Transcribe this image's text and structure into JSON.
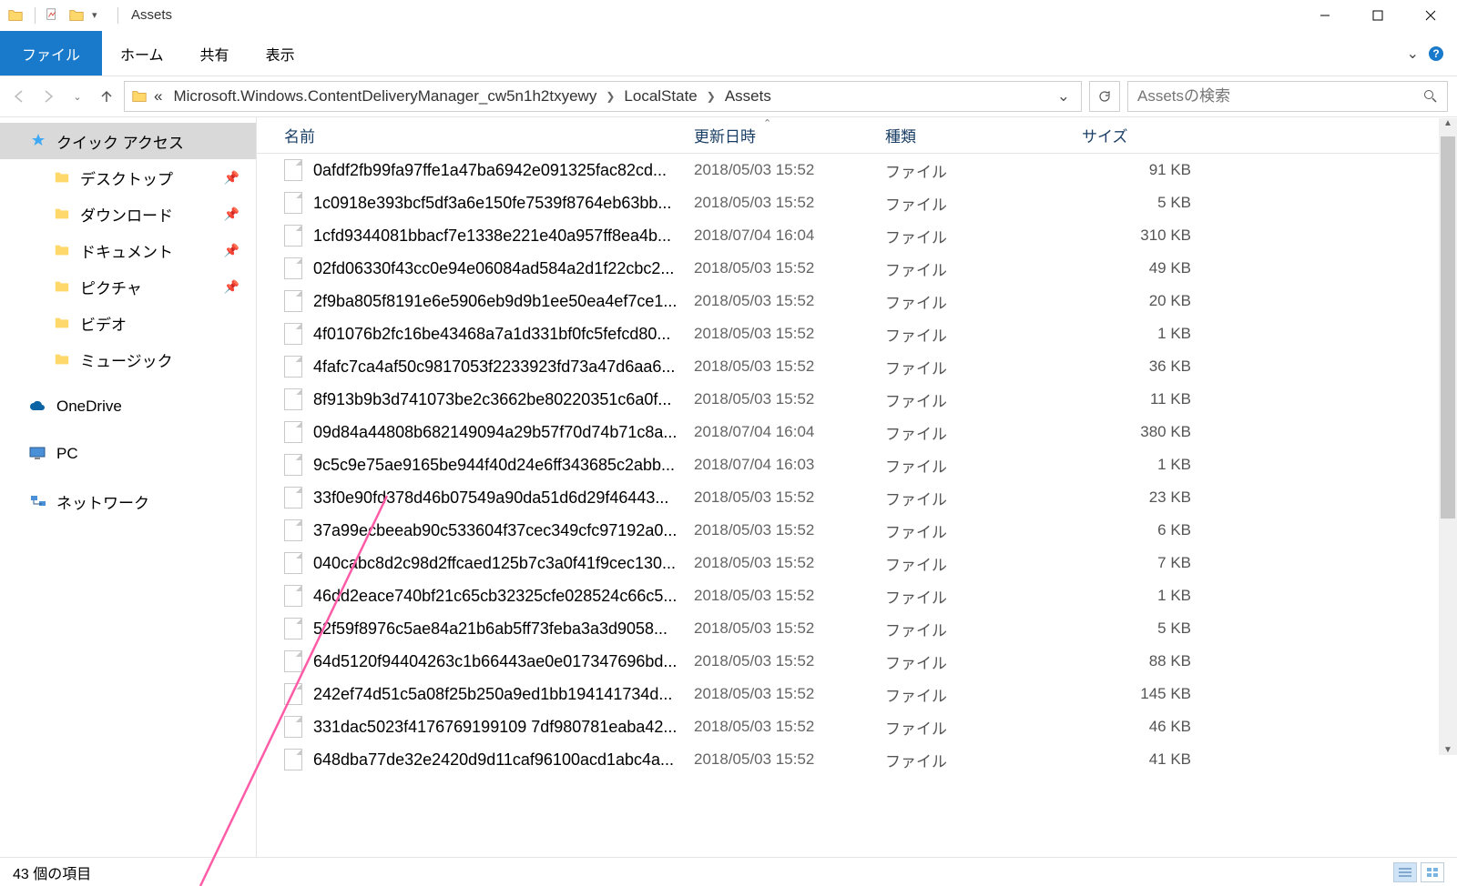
{
  "window": {
    "title": "Assets"
  },
  "ribbon": {
    "file": "ファイル",
    "home": "ホーム",
    "share": "共有",
    "view": "表示"
  },
  "breadcrumb": {
    "prefix": "«",
    "parts": [
      "Microsoft.Windows.ContentDeliveryManager_cw5n1h2txyewy",
      "LocalState",
      "Assets"
    ]
  },
  "search": {
    "placeholder": "Assetsの検索"
  },
  "nav": {
    "quick": "クイック アクセス",
    "desktop": "デスクトップ",
    "downloads": "ダウンロード",
    "documents": "ドキュメント",
    "pictures": "ピクチャ",
    "videos": "ビデオ",
    "music": "ミュージック",
    "onedrive": "OneDrive",
    "pc": "PC",
    "network": "ネットワーク"
  },
  "columns": {
    "name": "名前",
    "date": "更新日時",
    "type": "種類",
    "size": "サイズ"
  },
  "files": [
    {
      "name": "0afdf2fb99fa97ffe1a47ba6942e091325fac82cd...",
      "date": "2018/05/03 15:52",
      "type": "ファイル",
      "size": "91 KB"
    },
    {
      "name": "1c0918e393bcf5df3a6e150fe7539f8764eb63bb...",
      "date": "2018/05/03 15:52",
      "type": "ファイル",
      "size": "5 KB"
    },
    {
      "name": "1cfd9344081bbacf7e1338e221e40a957ff8ea4b...",
      "date": "2018/07/04 16:04",
      "type": "ファイル",
      "size": "310 KB"
    },
    {
      "name": "02fd06330f43cc0e94e06084ad584a2d1f22cbc2...",
      "date": "2018/05/03 15:52",
      "type": "ファイル",
      "size": "49 KB"
    },
    {
      "name": "2f9ba805f8191e6e5906eb9d9b1ee50ea4ef7ce1...",
      "date": "2018/05/03 15:52",
      "type": "ファイル",
      "size": "20 KB"
    },
    {
      "name": "4f01076b2fc16be43468a7a1d331bf0fc5fefcd80...",
      "date": "2018/05/03 15:52",
      "type": "ファイル",
      "size": "1 KB"
    },
    {
      "name": "4fafc7ca4af50c9817053f2233923fd73a47d6aa6...",
      "date": "2018/05/03 15:52",
      "type": "ファイル",
      "size": "36 KB"
    },
    {
      "name": "8f913b9b3d741073be2c3662be80220351c6a0f...",
      "date": "2018/05/03 15:52",
      "type": "ファイル",
      "size": "11 KB"
    },
    {
      "name": "09d84a44808b682149094a29b57f70d74b71c8a...",
      "date": "2018/07/04 16:04",
      "type": "ファイル",
      "size": "380 KB"
    },
    {
      "name": "9c5c9e75ae9165be944f40d24e6ff343685c2abb...",
      "date": "2018/07/04 16:03",
      "type": "ファイル",
      "size": "1 KB"
    },
    {
      "name": "33f0e90fd378d46b07549a90da51d6d29f46443...",
      "date": "2018/05/03 15:52",
      "type": "ファイル",
      "size": "23 KB"
    },
    {
      "name": "37a99ecbeeab90c533604f37cec349cfc97192a0...",
      "date": "2018/05/03 15:52",
      "type": "ファイル",
      "size": "6 KB"
    },
    {
      "name": "040cabc8d2c98d2ffcaed125b7c3a0f41f9cec130...",
      "date": "2018/05/03 15:52",
      "type": "ファイル",
      "size": "7 KB"
    },
    {
      "name": "46dd2eace740bf21c65cb32325cfe028524c66c5...",
      "date": "2018/05/03 15:52",
      "type": "ファイル",
      "size": "1 KB"
    },
    {
      "name": "52f59f8976c5ae84a21b6ab5ff73feba3a3d9058...",
      "date": "2018/05/03 15:52",
      "type": "ファイル",
      "size": "5 KB"
    },
    {
      "name": "64d5120f94404263c1b66443ae0e017347696bd...",
      "date": "2018/05/03 15:52",
      "type": "ファイル",
      "size": "88 KB"
    },
    {
      "name": "242ef74d51c5a08f25b250a9ed1bb194141734d...",
      "date": "2018/05/03 15:52",
      "type": "ファイル",
      "size": "145 KB"
    },
    {
      "name": "331dac5023f4176769199109 7df980781eaba42...",
      "date": "2018/05/03 15:52",
      "type": "ファイル",
      "size": "46 KB"
    },
    {
      "name": "648dba77de32e2420d9d11caf96100acd1abc4a...",
      "date": "2018/05/03 15:52",
      "type": "ファイル",
      "size": "41 KB"
    }
  ],
  "status": {
    "count": "43 個の項目"
  }
}
